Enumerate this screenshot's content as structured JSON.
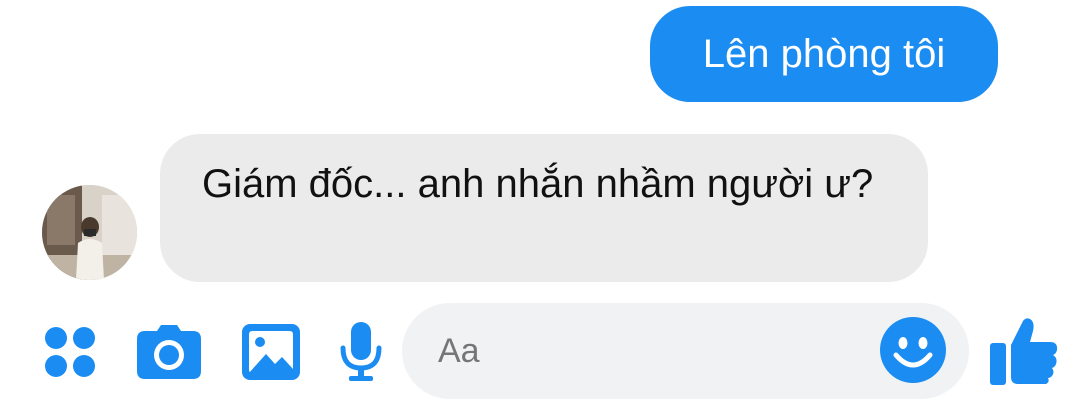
{
  "colors": {
    "accent": "#1a8cf2",
    "incoming_bubble": "#ebebeb",
    "input_bg": "#f1f2f4"
  },
  "messages": {
    "outgoing": {
      "text": "Lên phòng tôi"
    },
    "incoming": {
      "text": "Giám đốc... anh nhắn nhầm người ư?"
    }
  },
  "composer": {
    "placeholder": "Aa",
    "icons": [
      "menu-dots-icon",
      "camera-icon",
      "image-icon",
      "microphone-icon",
      "emoji-icon",
      "thumbs-up-icon"
    ]
  }
}
